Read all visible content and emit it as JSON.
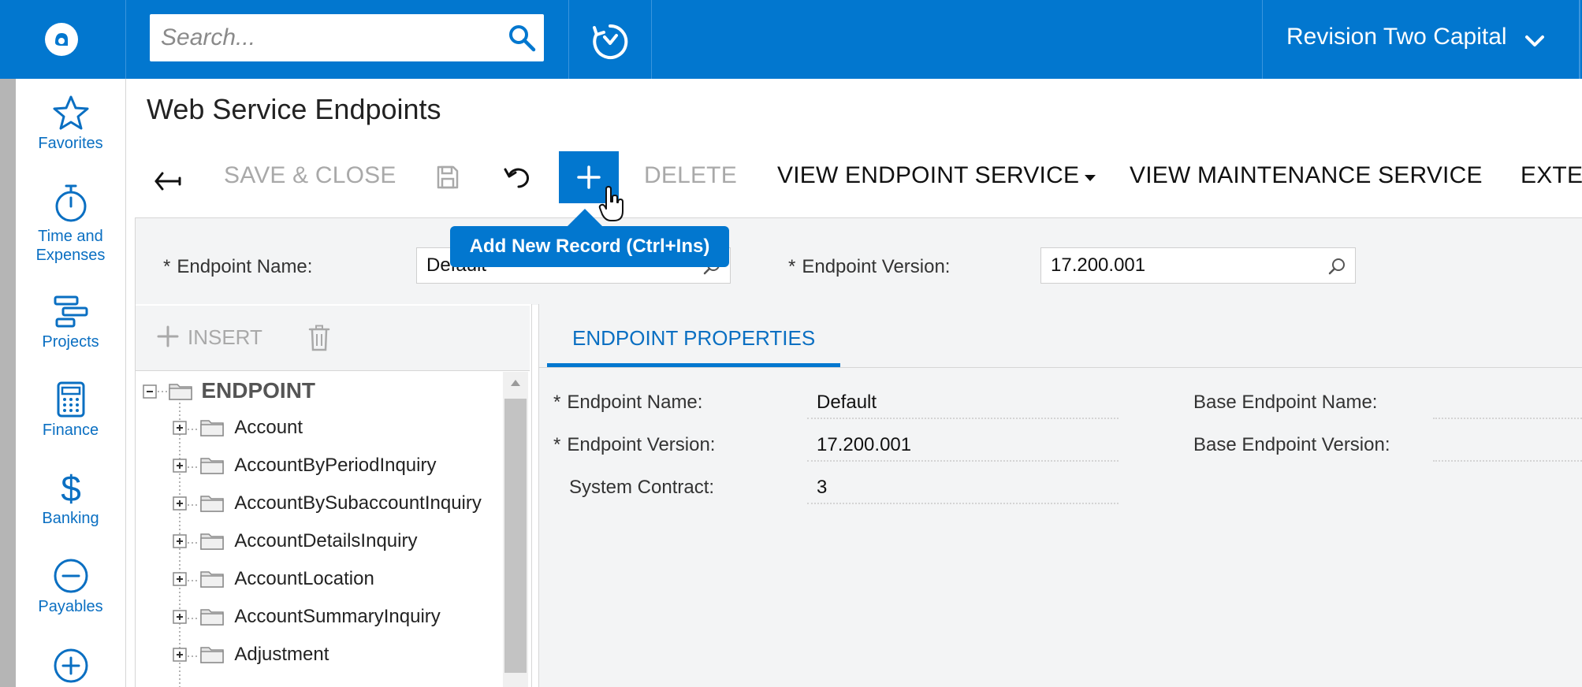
{
  "topbar": {
    "search_placeholder": "Search...",
    "company": "Revision Two Capital"
  },
  "nav": {
    "items": [
      {
        "label": "Favorites",
        "icon": "star-icon"
      },
      {
        "label": "Time and Expenses",
        "icon": "stopwatch-icon"
      },
      {
        "label": "Projects",
        "icon": "projects-icon"
      },
      {
        "label": "Finance",
        "icon": "calculator-icon"
      },
      {
        "label": "Banking",
        "icon": "dollar-icon"
      },
      {
        "label": "Payables",
        "icon": "minus-circle-icon"
      },
      {
        "label": "",
        "icon": "plus-circle-icon"
      }
    ]
  },
  "page": {
    "title": "Web Service Endpoints"
  },
  "toolbar": {
    "save_close": "SAVE & CLOSE",
    "delete": "DELETE",
    "view_endpoint_service": "VIEW ENDPOINT SERVICE",
    "view_maintenance_service": "VIEW MAINTENANCE SERVICE",
    "extend": "EXTE",
    "add_tooltip": "Add New Record (Ctrl+Ins)"
  },
  "form": {
    "endpoint_name_label": "Endpoint Name:",
    "endpoint_name_value": "Default",
    "endpoint_version_label": "Endpoint Version:",
    "endpoint_version_value": "17.200.001",
    "required_mark": "*"
  },
  "tree": {
    "insert_label": "INSERT",
    "root": "ENDPOINT",
    "items": [
      "Account",
      "AccountByPeriodInquiry",
      "AccountBySubaccountInquiry",
      "AccountDetailsInquiry",
      "AccountLocation",
      "AccountSummaryInquiry",
      "Adjustment"
    ]
  },
  "properties": {
    "tab_label": "ENDPOINT PROPERTIES",
    "endpoint_name_label": "Endpoint Name:",
    "endpoint_name_value": "Default",
    "endpoint_version_label": "Endpoint Version:",
    "endpoint_version_value": "17.200.001",
    "system_contract_label": "System Contract:",
    "system_contract_value": "3",
    "base_endpoint_name_label": "Base Endpoint Name:",
    "base_endpoint_version_label": "Base Endpoint Version:"
  },
  "colors": {
    "accent": "#0277cf",
    "nav_text": "#0a6fc2",
    "disabled": "#a9a9a9"
  }
}
